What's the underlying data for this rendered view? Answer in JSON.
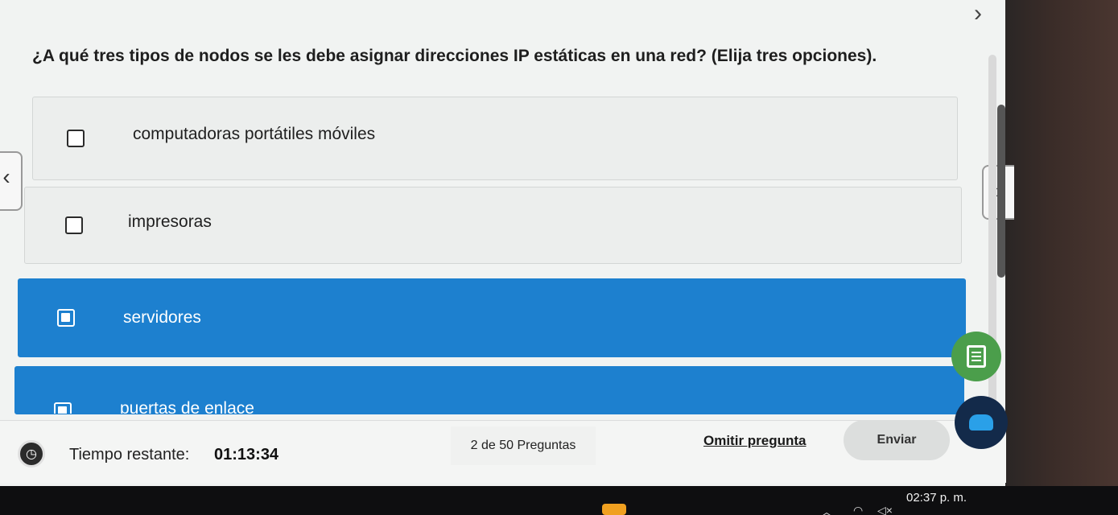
{
  "question": {
    "text": "¿A qué tres tipos de nodos se les debe asignar direcciones IP estáticas en una red? (Elija tres opciones)."
  },
  "options": [
    {
      "label": "computadoras portátiles móviles",
      "selected": false
    },
    {
      "label": "impresoras",
      "selected": false
    },
    {
      "label": "servidores",
      "selected": true
    },
    {
      "label": "puertas de enlace",
      "selected": true
    }
  ],
  "nav": {
    "next_glyph": "›",
    "prev_glyph": "‹",
    "side_next_glyph": "›"
  },
  "footer": {
    "timer_label": "Tiempo restante:",
    "timer_value": "01:13:34",
    "question_counter": "2 de 50 Preguntas",
    "skip_label": "Omitir pregunta",
    "submit_label": "Enviar"
  },
  "taskbar": {
    "time": "02:37 p. m."
  },
  "colors": {
    "selected_option": "#1d80cf",
    "notes_button": "#4b9e4b",
    "assistant_button": "#132a4a"
  },
  "icons": {
    "timer": "timer-icon",
    "notes": "notes-icon",
    "assistant": "assistant-icon"
  }
}
